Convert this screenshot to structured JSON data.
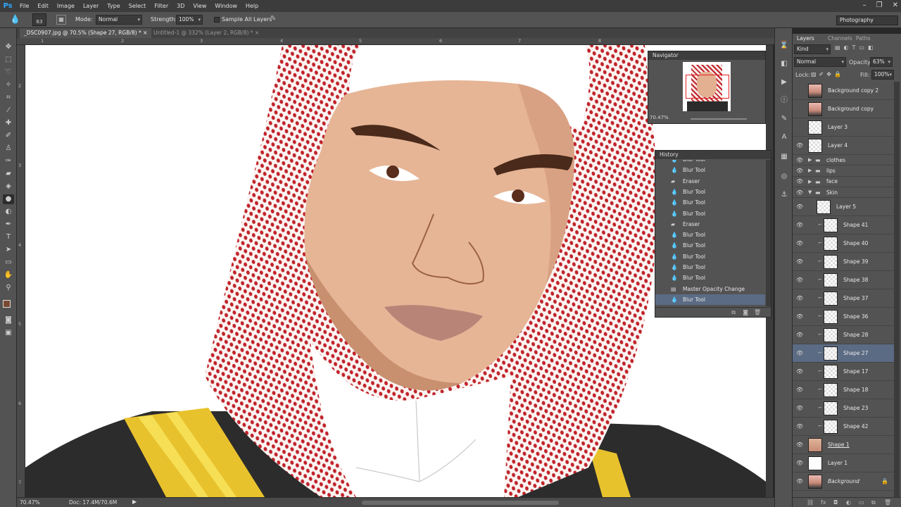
{
  "app": {
    "logo": "Ps"
  },
  "menu": [
    "File",
    "Edit",
    "Image",
    "Layer",
    "Type",
    "Select",
    "Filter",
    "3D",
    "View",
    "Window",
    "Help"
  ],
  "window_controls": [
    "–",
    "❐",
    "✕"
  ],
  "options": {
    "brush_size": "63",
    "mode_label": "Mode:",
    "mode_value": "Normal",
    "strength_label": "Strength:",
    "strength_value": "100%",
    "sample_all": "Sample All Layers"
  },
  "workspace": "Photography",
  "tabs": [
    {
      "label": "_DSC0907.jpg @ 70.5% (Shape 27, RGB/8) *",
      "close": "×"
    },
    {
      "label": "Untitled-1 @ 332% (Layer 2, RGB/8) *",
      "close": "×"
    }
  ],
  "rulers": {
    "h": [
      "1",
      "2",
      "3",
      "4",
      "5",
      "6",
      "7",
      "8"
    ],
    "v": [
      "2",
      "3",
      "4",
      "5",
      "6",
      "7",
      "8"
    ]
  },
  "status": {
    "zoom": "70.47%",
    "doc": "Doc: 17.4M/70.6M"
  },
  "navigator": {
    "title": "Navigator",
    "zoom": "70.47%"
  },
  "history": {
    "title": "History",
    "items": [
      {
        "icon": "blur-icon",
        "label": "Blur Tool"
      },
      {
        "icon": "blur-icon",
        "label": "Blur Tool"
      },
      {
        "icon": "eraser-icon",
        "label": "Eraser"
      },
      {
        "icon": "blur-icon",
        "label": "Blur Tool"
      },
      {
        "icon": "blur-icon",
        "label": "Blur Tool"
      },
      {
        "icon": "blur-icon",
        "label": "Blur Tool"
      },
      {
        "icon": "eraser-icon",
        "label": "Eraser"
      },
      {
        "icon": "blur-icon",
        "label": "Blur Tool"
      },
      {
        "icon": "blur-icon",
        "label": "Blur Tool"
      },
      {
        "icon": "blur-icon",
        "label": "Blur Tool"
      },
      {
        "icon": "blur-icon",
        "label": "Blur Tool"
      },
      {
        "icon": "blur-icon",
        "label": "Blur Tool"
      },
      {
        "icon": "master-opacity-icon",
        "label": "Master Opacity Change"
      },
      {
        "icon": "blur-icon",
        "label": "Blur Tool"
      }
    ]
  },
  "layers_panel": {
    "tabs": [
      "Layers",
      "Channels",
      "Paths"
    ],
    "kind": "Kind",
    "blend_mode": "Normal",
    "opacity_label": "Opacity:",
    "opacity_value": "63%",
    "lock_label": "Lock:",
    "fill_label": "Fill:",
    "fill_value": "100%",
    "layers": [
      {
        "name": "Background copy 2",
        "thumb": "photo",
        "eye": false
      },
      {
        "name": "Background copy",
        "thumb": "photo",
        "eye": false
      },
      {
        "name": "Layer 3",
        "thumb": "trans",
        "eye": false
      },
      {
        "name": "Layer 4",
        "thumb": "trans",
        "eye": true
      },
      {
        "name": "clothes",
        "group": true,
        "eye": true
      },
      {
        "name": "lips",
        "group": true,
        "eye": true
      },
      {
        "name": "face",
        "group": true,
        "eye": true
      },
      {
        "name": "Skin",
        "group": true,
        "open": true,
        "eye": true
      },
      {
        "name": "Layer 5",
        "thumb": "trans",
        "eye": true,
        "indent": true
      },
      {
        "name": "Shape 41",
        "thumb": "trans",
        "eye": true,
        "clip": true
      },
      {
        "name": "Shape 40",
        "thumb": "trans",
        "eye": true,
        "clip": true
      },
      {
        "name": "Shape 39",
        "thumb": "trans",
        "eye": true,
        "clip": true
      },
      {
        "name": "Shape 38",
        "thumb": "trans",
        "eye": true,
        "clip": true
      },
      {
        "name": "Shape 37",
        "thumb": "trans",
        "eye": true,
        "clip": true
      },
      {
        "name": "Shape 36",
        "thumb": "trans",
        "eye": true,
        "clip": true
      },
      {
        "name": "Shape 28",
        "thumb": "trans",
        "eye": true,
        "clip": true
      },
      {
        "name": "Shape 27",
        "thumb": "trans",
        "eye": true,
        "clip": true,
        "selected": true
      },
      {
        "name": "Shape 17",
        "thumb": "trans",
        "eye": true,
        "clip": true
      },
      {
        "name": "Shape 18",
        "thumb": "trans",
        "eye": true,
        "clip": true
      },
      {
        "name": "Shape 23",
        "thumb": "trans",
        "eye": true,
        "clip": true
      },
      {
        "name": "Shape 42",
        "thumb": "trans",
        "eye": true,
        "clip": true
      },
      {
        "name": "Shape 1",
        "thumb": "skin",
        "eye": true,
        "underline": true
      },
      {
        "name": "Layer 1",
        "thumb": "white",
        "eye": true
      },
      {
        "name": "Background",
        "thumb": "photo",
        "eye": true,
        "italic": true,
        "locked": true
      }
    ]
  }
}
